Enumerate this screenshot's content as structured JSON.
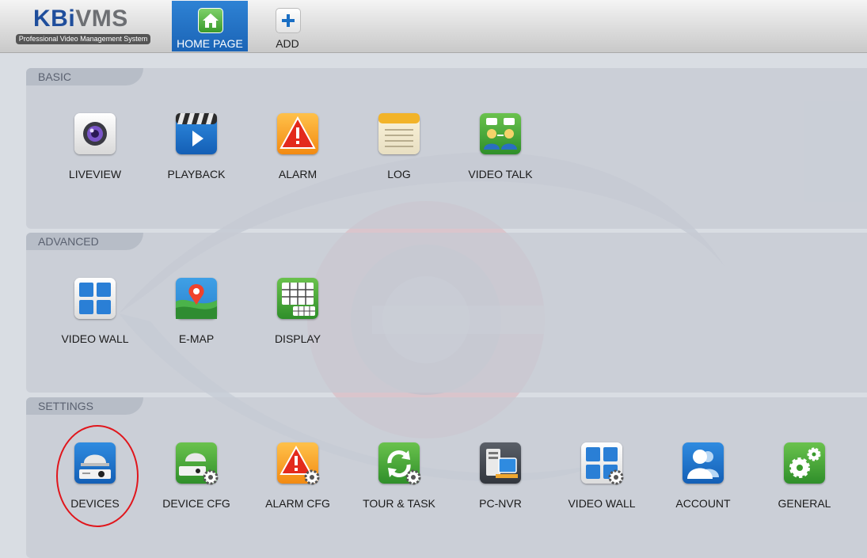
{
  "app": {
    "logo_title": "KBiVMS",
    "logo_subtitle": "Professional Video Management System"
  },
  "tabs": [
    {
      "label": "HOME PAGE",
      "active": true,
      "icon": "home-icon"
    },
    {
      "label": "ADD",
      "active": false,
      "icon": "plus-icon"
    }
  ],
  "sections": {
    "basic": {
      "title": "BASIC",
      "items": [
        {
          "label": "LIVEVIEW",
          "icon": "camera-lens-icon"
        },
        {
          "label": "PLAYBACK",
          "icon": "clapperboard-play-icon"
        },
        {
          "label": "ALARM",
          "icon": "alarm-warning-icon"
        },
        {
          "label": "LOG",
          "icon": "notepad-log-icon"
        },
        {
          "label": "VIDEO TALK",
          "icon": "video-talk-icon"
        }
      ]
    },
    "advanced": {
      "title": "ADVANCED",
      "items": [
        {
          "label": "VIDEO WALL",
          "icon": "video-wall-icon"
        },
        {
          "label": "E-MAP",
          "icon": "map-pin-icon"
        },
        {
          "label": "DISPLAY",
          "icon": "display-grid-icon"
        }
      ]
    },
    "settings": {
      "title": "SETTINGS",
      "items": [
        {
          "label": "DEVICES",
          "icon": "dome-camera-icon"
        },
        {
          "label": "DEVICE CFG",
          "icon": "device-config-icon"
        },
        {
          "label": "ALARM CFG",
          "icon": "alarm-config-icon"
        },
        {
          "label": "TOUR & TASK",
          "icon": "tour-task-icon"
        },
        {
          "label": "PC-NVR",
          "icon": "pc-nvr-icon"
        },
        {
          "label": "VIDEO WALL",
          "icon": "video-wall-config-icon"
        },
        {
          "label": "ACCOUNT",
          "icon": "account-users-icon"
        },
        {
          "label": "GENERAL",
          "icon": "general-gears-icon"
        }
      ]
    }
  },
  "highlight": {
    "target": "DEVICES",
    "color": "#e0161c"
  },
  "colors": {
    "accent": "#1b64b6",
    "panel": "#c6cbd4"
  }
}
